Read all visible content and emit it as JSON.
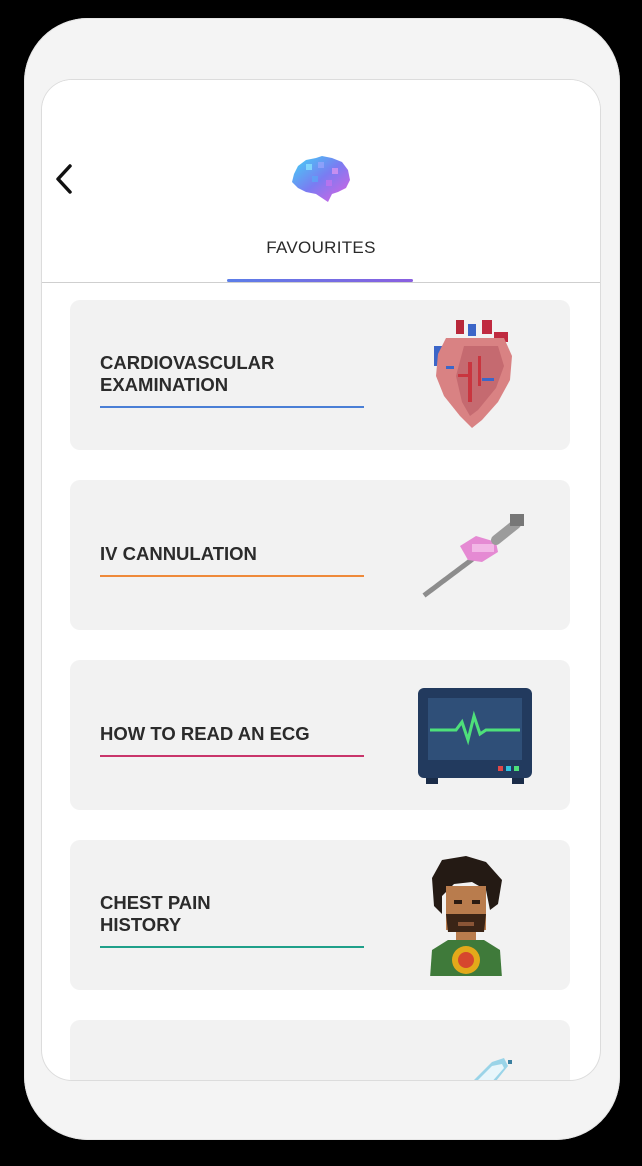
{
  "header": {
    "tab_label": "FAVOURITES",
    "accent_gradient": [
      "#5b7ee8",
      "#8a5fe0"
    ]
  },
  "favourites": [
    {
      "title": "CARDIOVASCULAR\nEXAMINATION",
      "line_color": "#4a7fd6",
      "art": "heart-icon"
    },
    {
      "title": "IV CANNULATION",
      "line_color": "#ef8a3a",
      "art": "cannula-icon"
    },
    {
      "title": "HOW TO READ AN ECG",
      "line_color": "#c9356b",
      "art": "ecg-monitor-icon"
    },
    {
      "title": "CHEST PAIN\nHISTORY",
      "line_color": "#1fa08a",
      "art": "patient-avatar-icon"
    },
    {
      "title": "",
      "line_color": "",
      "art": "bacteria-icon"
    }
  ]
}
